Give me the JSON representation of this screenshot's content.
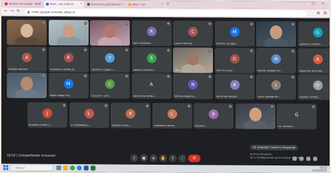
{
  "browser": {
    "tabs": [
      {
        "title": "Reunión de trabajo - Meet",
        "color": "#d93025"
      },
      {
        "title": "Meet - abc-defg-hij",
        "color": "#1a73e8"
      },
      {
        "title": "Asistencia participantes",
        "color": "#188038"
      },
      {
        "title": "Meet - xyz",
        "color": "#f9ab00"
      }
    ],
    "new_tab": "+",
    "url": "meet.google.com/abc-defg-hij"
  },
  "meet": {
    "tiles": [
      {
        "name": "",
        "kind": "video"
      },
      {
        "name": "",
        "kind": "video"
      },
      {
        "name": "",
        "kind": "video"
      },
      {
        "name": "Ruth Villarroel...",
        "initial": "R",
        "color": "#7b6cb3"
      },
      {
        "name": "Cesar Ramirez",
        "initial": "C",
        "color": "#a05a52"
      },
      {
        "name": "Mónica Carvajal...",
        "initial": "M",
        "color": "#1a73e8"
      },
      {
        "name": "",
        "kind": "video"
      },
      {
        "name": "Gabriela Cordero...",
        "initial": "G",
        "color": "#12a4b8"
      },
      {
        "name": "Anabell Romero",
        "initial": "A",
        "color": "#b0574a"
      },
      {
        "name": "ROLANDO HUANCA...",
        "initial": "R",
        "color": "#a45050"
      },
      {
        "name": "Yasmine Colque C...",
        "initial": "Y",
        "color": "#5b9bd5"
      },
      {
        "name": "Sandra Sanchez...",
        "initial": "S",
        "color": "#34a853"
      },
      {
        "name": "Yani...",
        "kind": "video"
      },
      {
        "name": "DAYTIN CEOS",
        "initial": "D",
        "color": "#9c5248"
      },
      {
        "name": "Nélson Quispe Ort...",
        "initial": "N",
        "color": "#5b8ec9"
      },
      {
        "name": "Alejandra Arce Ma...",
        "initial": "A",
        "color": "#d35b3e"
      },
      {
        "name": "",
        "kind": "video"
      },
      {
        "name": "María Isabel Pra...",
        "initial": "M",
        "color": "#1a73e8"
      },
      {
        "name": "CECILIA Y DEP...",
        "initial": "C",
        "color": "#5f9a4a"
      },
      {
        "name": "Autónoma Verdú...",
        "initial": "A",
        "color": "#3c4043"
      },
      {
        "name": "Norma Angélica...",
        "initial": "N",
        "color": "#5e5ab8"
      },
      {
        "name": "Alicia Hernández...",
        "initial": "A",
        "color": "#8a7fb8"
      },
      {
        "name": "Lucia Gallego Mi...",
        "initial": "L",
        "color": "#8f7f72"
      },
      {
        "name": "Diadem Gómez...",
        "initial": "D",
        "color": "#9aa0a6"
      },
      {
        "name": "Jhandira Cohen L...",
        "initial": "J",
        "color": "#d14b3c"
      },
      {
        "name": "LI FERNÁNDEZ...",
        "initial": "L",
        "color": "#c25a48"
      },
      {
        "name": "Rosalia Prieto...",
        "initial": "R",
        "color": "#b86e4f"
      },
      {
        "name": "Laureano Camar...",
        "initial": "L",
        "color": "#c27a5c"
      },
      {
        "name": "Rosario...",
        "initial": "R",
        "color": "#9b6bb5"
      },
      {
        "name": "",
        "kind": "video"
      },
      {
        "name": "Tú, Gonzalo...",
        "initial": "G",
        "color": "#3c4043"
      }
    ],
    "time": "10:02",
    "meeting_label": "Compartiendo invitación",
    "present_pill": "Tú: Autorizar Control y Suspende",
    "notice_lines": [
      "Activar Windows",
      "Ve a Configuración para activar Windows."
    ],
    "controls": [
      "mic-icon",
      "camera-icon",
      "captions-icon",
      "raise-hand-icon",
      "present-icon",
      "more-options-icon"
    ],
    "end_call_label": "✆"
  },
  "taskbar": {
    "search_placeholder": "Buscar",
    "clock_time": "10:02",
    "clock_date": "01/03/2022"
  }
}
